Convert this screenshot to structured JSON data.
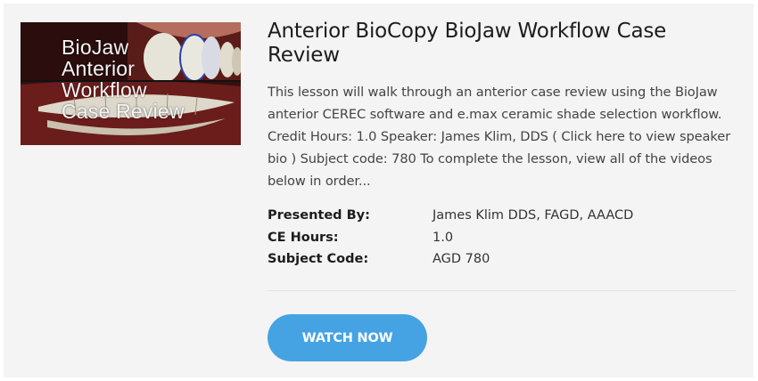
{
  "course": {
    "thumbnail_text": "BioJaw\nAnterior\nWorkflow\nCase Review",
    "title": "Anterior BioCopy BioJaw Workflow Case Review",
    "description": "This lesson will walk through an anterior case review using the BioJaw anterior CEREC software and e.max ceramic shade selection workflow. Credit Hours: 1.0 Speaker: James Klim, DDS ( Click here to view speaker bio ) Subject code: 780 To complete the lesson, view all of the videos below in order...",
    "meta": [
      {
        "label": "Presented By:",
        "value": "James Klim DDS, FAGD, AAACD"
      },
      {
        "label": "CE Hours:",
        "value": "1.0"
      },
      {
        "label": "Subject Code:",
        "value": "AGD 780"
      }
    ],
    "watch_label": "WATCH NOW"
  },
  "colors": {
    "button": "#45a3e3",
    "card_background": "#f4f4f4"
  }
}
